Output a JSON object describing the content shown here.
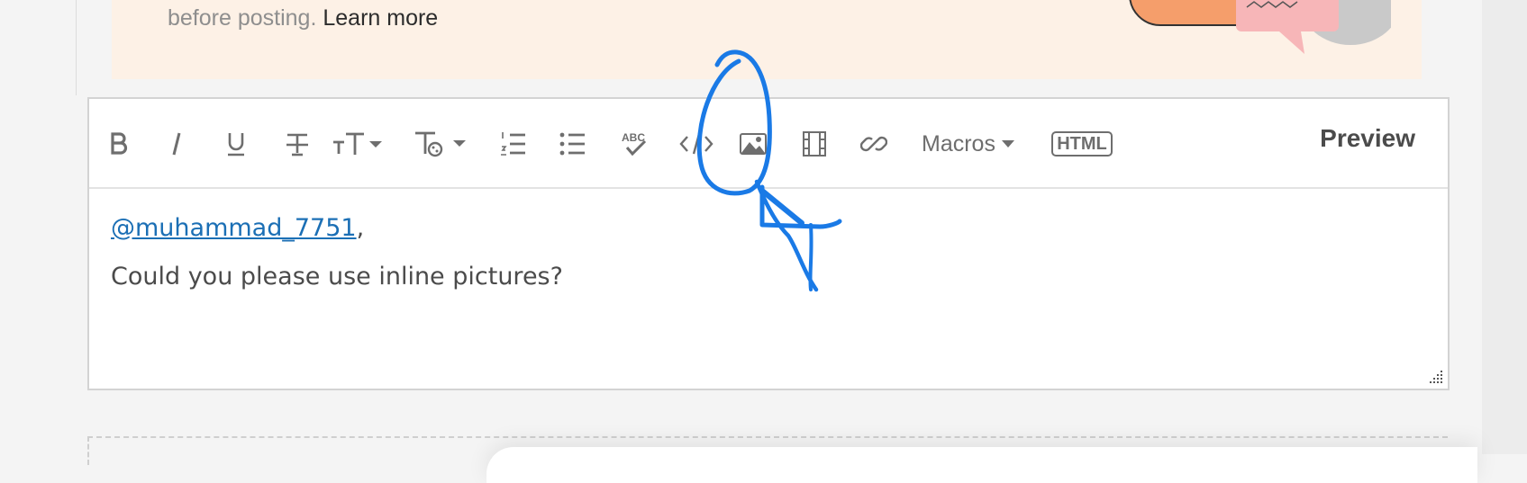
{
  "banner": {
    "text": "before posting.",
    "link": "Learn more"
  },
  "toolbar": {
    "buttons": [
      "bold-icon",
      "italic-icon",
      "underline-icon",
      "strikethrough-icon",
      "font-size-icon",
      "text-style-icon",
      "numbered-list-icon",
      "bulleted-list-icon",
      "spellcheck-icon",
      "code-icon",
      "insert-image-icon",
      "insert-video-icon",
      "insert-link-icon"
    ],
    "macros_label": "Macros",
    "html_label": "HTML",
    "preview_label": "Preview"
  },
  "editor": {
    "mention": "@muhammad_7751",
    "mention_suffix": ",",
    "message": "Could you please use inline pictures?"
  },
  "colors": {
    "banner_bg": "#fdf1e6",
    "mention": "#1b6fb5",
    "annotation": "#1a7ae6"
  }
}
